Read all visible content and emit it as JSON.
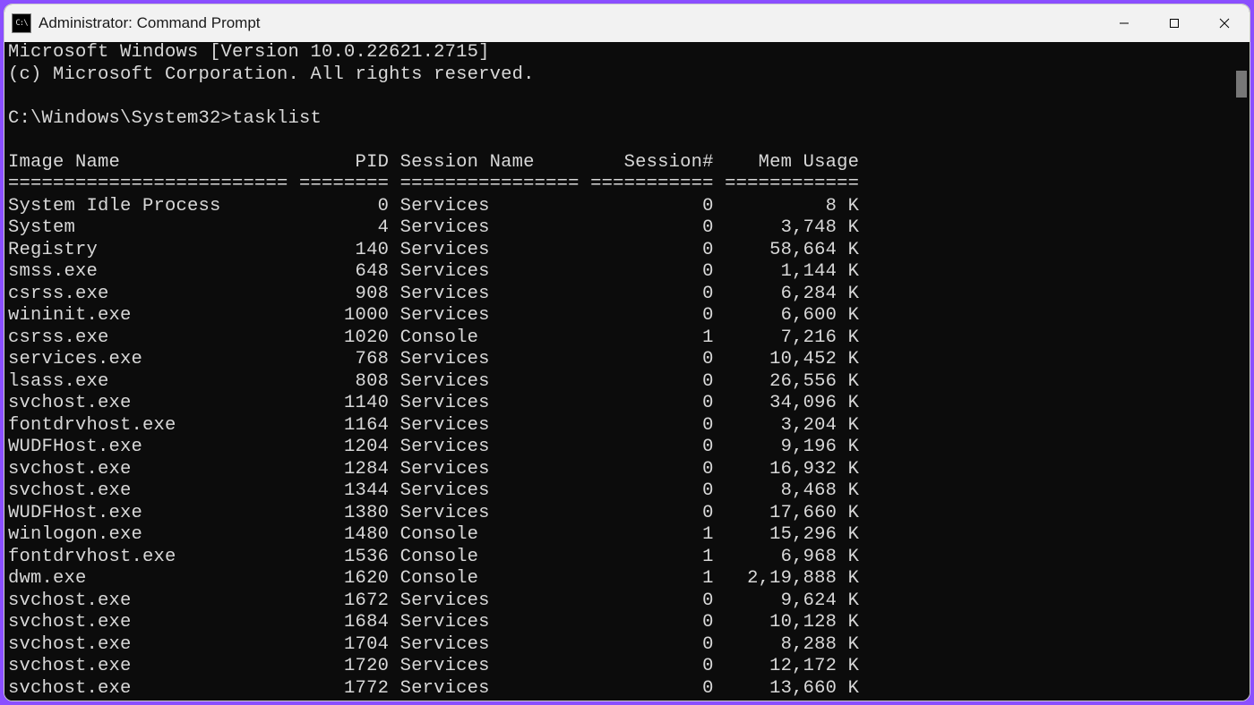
{
  "window": {
    "title": "Administrator: Command Prompt"
  },
  "terminal": {
    "banner1": "Microsoft Windows [Version 10.0.22621.2715]",
    "banner2": "(c) Microsoft Corporation. All rights reserved.",
    "prompt": "C:\\Windows\\System32>",
    "command": "tasklist",
    "headers": {
      "image": "Image Name",
      "pid": "PID",
      "session_name": "Session Name",
      "session_num": "Session#",
      "mem": "Mem Usage"
    },
    "separator": "========================= ======== ================ =========== ============",
    "rows": [
      {
        "image": "System Idle Process",
        "pid": "0",
        "sname": "Services",
        "snum": "0",
        "mem": "8 K"
      },
      {
        "image": "System",
        "pid": "4",
        "sname": "Services",
        "snum": "0",
        "mem": "3,748 K"
      },
      {
        "image": "Registry",
        "pid": "140",
        "sname": "Services",
        "snum": "0",
        "mem": "58,664 K"
      },
      {
        "image": "smss.exe",
        "pid": "648",
        "sname": "Services",
        "snum": "0",
        "mem": "1,144 K"
      },
      {
        "image": "csrss.exe",
        "pid": "908",
        "sname": "Services",
        "snum": "0",
        "mem": "6,284 K"
      },
      {
        "image": "wininit.exe",
        "pid": "1000",
        "sname": "Services",
        "snum": "0",
        "mem": "6,600 K"
      },
      {
        "image": "csrss.exe",
        "pid": "1020",
        "sname": "Console",
        "snum": "1",
        "mem": "7,216 K"
      },
      {
        "image": "services.exe",
        "pid": "768",
        "sname": "Services",
        "snum": "0",
        "mem": "10,452 K"
      },
      {
        "image": "lsass.exe",
        "pid": "808",
        "sname": "Services",
        "snum": "0",
        "mem": "26,556 K"
      },
      {
        "image": "svchost.exe",
        "pid": "1140",
        "sname": "Services",
        "snum": "0",
        "mem": "34,096 K"
      },
      {
        "image": "fontdrvhost.exe",
        "pid": "1164",
        "sname": "Services",
        "snum": "0",
        "mem": "3,204 K"
      },
      {
        "image": "WUDFHost.exe",
        "pid": "1204",
        "sname": "Services",
        "snum": "0",
        "mem": "9,196 K"
      },
      {
        "image": "svchost.exe",
        "pid": "1284",
        "sname": "Services",
        "snum": "0",
        "mem": "16,932 K"
      },
      {
        "image": "svchost.exe",
        "pid": "1344",
        "sname": "Services",
        "snum": "0",
        "mem": "8,468 K"
      },
      {
        "image": "WUDFHost.exe",
        "pid": "1380",
        "sname": "Services",
        "snum": "0",
        "mem": "17,660 K"
      },
      {
        "image": "winlogon.exe",
        "pid": "1480",
        "sname": "Console",
        "snum": "1",
        "mem": "15,296 K"
      },
      {
        "image": "fontdrvhost.exe",
        "pid": "1536",
        "sname": "Console",
        "snum": "1",
        "mem": "6,968 K"
      },
      {
        "image": "dwm.exe",
        "pid": "1620",
        "sname": "Console",
        "snum": "1",
        "mem": "2,19,888 K"
      },
      {
        "image": "svchost.exe",
        "pid": "1672",
        "sname": "Services",
        "snum": "0",
        "mem": "9,624 K"
      },
      {
        "image": "svchost.exe",
        "pid": "1684",
        "sname": "Services",
        "snum": "0",
        "mem": "10,128 K"
      },
      {
        "image": "svchost.exe",
        "pid": "1704",
        "sname": "Services",
        "snum": "0",
        "mem": "8,288 K"
      },
      {
        "image": "svchost.exe",
        "pid": "1720",
        "sname": "Services",
        "snum": "0",
        "mem": "12,172 K"
      },
      {
        "image": "svchost.exe",
        "pid": "1772",
        "sname": "Services",
        "snum": "0",
        "mem": "13,660 K"
      }
    ]
  }
}
